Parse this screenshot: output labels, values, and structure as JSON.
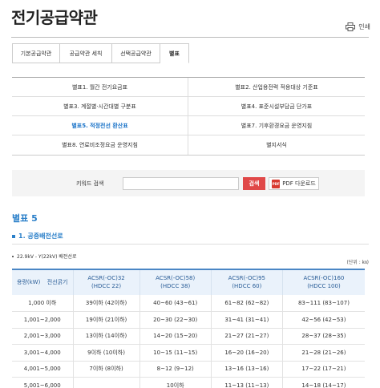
{
  "header": {
    "title": "전기공급약관",
    "print_label": "인쇄"
  },
  "tabs": [
    {
      "label": "기본공급약관",
      "active": false
    },
    {
      "label": "공급약관 세칙",
      "active": false
    },
    {
      "label": "선택공급약관",
      "active": false
    },
    {
      "label": "별표",
      "active": true
    }
  ],
  "annex_links": [
    {
      "label": "별표1. 월간 전기요금표",
      "active": false
    },
    {
      "label": "별표2. 산업용전력 적용대상 기준표",
      "active": false
    },
    {
      "label": "별표3. 계절별·시간대별 구분표",
      "active": false
    },
    {
      "label": "별표4. 표준시설부담금 단가표",
      "active": false
    },
    {
      "label": "별표5. 적정전선 환산표",
      "active": true
    },
    {
      "label": "별표7. 기후환경요금 운영지침",
      "active": false
    },
    {
      "label": "별표8. 연료비조정요금 운영지침",
      "active": false
    },
    {
      "label": "별지서식",
      "active": false
    }
  ],
  "search": {
    "label": "키워드 검색",
    "value": "",
    "button": "검색",
    "pdf_button": "PDF 다운로드",
    "pdf_icon": "PDF"
  },
  "content": {
    "section_title": "별표 5",
    "subsection_title": "1. 공중배전선로",
    "spec_note": "22.9kV - Y(22kV) 배전선로",
    "unit_note": "(단위 : ㎞)"
  },
  "table": {
    "corner_left": "용량(kW)",
    "corner_right": "전선굵기",
    "columns": [
      {
        "line1": "ACSR(-OC)32",
        "line2": "(HDCC 22)"
      },
      {
        "line1": "ACSR(-OC)58)",
        "line2": "(HDCC 38)"
      },
      {
        "line1": "ACSR(-OC)95",
        "line2": "(HDCC 60)"
      },
      {
        "line1": "ACSR(-OC)160",
        "line2": "(HDCC 100)"
      }
    ],
    "rows": [
      [
        "1,000 이하",
        "39이하 (42이하)",
        "40~60 (43~61)",
        "61~82 (62~82)",
        "83~111 (83~107)"
      ],
      [
        "1,001~2,000",
        "19이하 (21이하)",
        "20~30 (22~30)",
        "31~41 (31~41)",
        "42~56 (42~53)"
      ],
      [
        "2,001~3,000",
        "13이하 (14이하)",
        "14~20 (15~20)",
        "21~27 (21~27)",
        "28~37 (28~35)"
      ],
      [
        "3,001~4,000",
        "9이하 (10이하)",
        "10~15 (11~15)",
        "16~20 (16~20)",
        "21~28 (21~26)"
      ],
      [
        "4,001~5,000",
        "7이하 (8이하)",
        "8~12 (9~12)",
        "13~16 (13~16)",
        "17~22 (17~21)"
      ],
      [
        "5,001~6,000",
        "",
        "10이하",
        "11~13 (11~13)",
        "14~18 (14~17)"
      ]
    ]
  },
  "colors": {
    "accent": "#2a7fc9",
    "search_button": "#e04848",
    "table_head_bg": "#eaf2fb"
  }
}
